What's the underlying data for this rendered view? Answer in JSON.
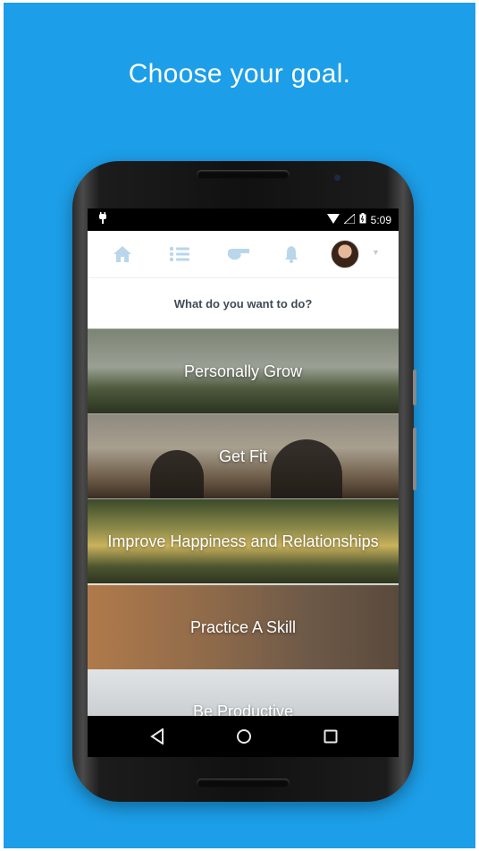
{
  "headline": "Choose your goal.",
  "status_bar": {
    "time": "5:09"
  },
  "nav": {
    "icons": [
      "home-icon",
      "list-icon",
      "whistle-icon",
      "bell-icon"
    ],
    "avatar": "user-avatar"
  },
  "prompt": "What do you want to do?",
  "goals": [
    {
      "label": "Personally Grow"
    },
    {
      "label": "Get Fit"
    },
    {
      "label": "Improve Happiness and Relationships"
    },
    {
      "label": "Practice A Skill"
    },
    {
      "label": "Be Productive"
    }
  ],
  "system_nav": [
    "back-icon",
    "home-circle-icon",
    "recents-icon"
  ],
  "colors": {
    "background": "#1c9ee8",
    "nav_icon": "#b9d6ea",
    "prompt_text": "#404a55"
  }
}
